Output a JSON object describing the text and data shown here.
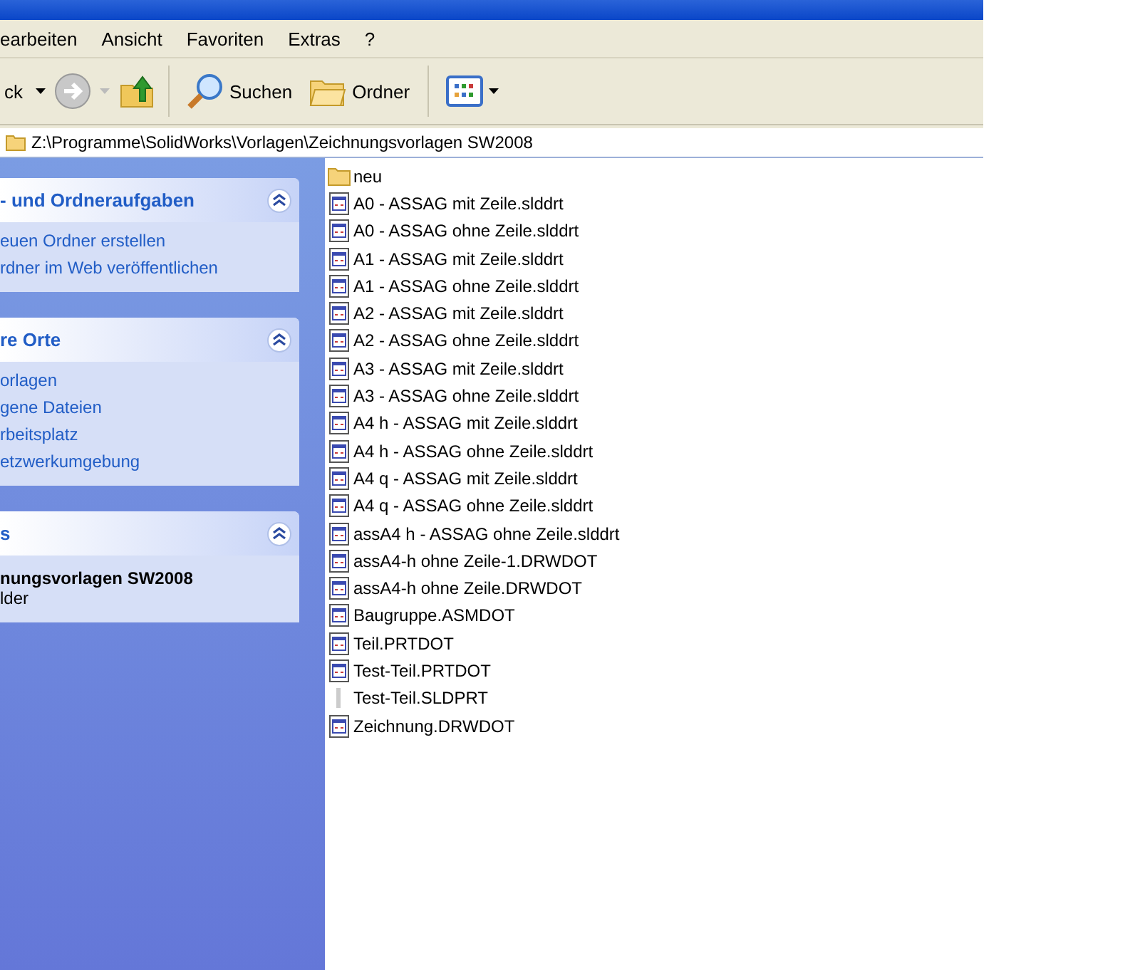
{
  "menu_bar": [
    "earbeiten",
    "Ansicht",
    "Favoriten",
    "Extras",
    "?"
  ],
  "toolbar": {
    "back": "ck",
    "search": "Suchen",
    "folders": "Ordner"
  },
  "address": "Z:\\Programme\\SolidWorks\\Vorlagen\\Zeichnungsvorlagen SW2008",
  "task_panels": [
    {
      "title": "- und Ordneraufgaben",
      "expanded": true,
      "kind": "links",
      "items": [
        "euen Ordner erstellen",
        "rdner im Web veröffentlichen"
      ]
    },
    {
      "title": "re Orte",
      "expanded": true,
      "kind": "links",
      "items": [
        "orlagen",
        "gene Dateien",
        "rbeitsplatz",
        "etzwerkumgebung"
      ]
    },
    {
      "title": "s",
      "expanded": true,
      "kind": "details",
      "items": [
        "nungsvorlagen SW2008",
        "lder"
      ]
    }
  ],
  "files": [
    {
      "name": "neu",
      "kind": "folder"
    },
    {
      "name": "A0 - ASSAG mit Zeile.slddrt",
      "kind": "template"
    },
    {
      "name": "A0 - ASSAG ohne Zeile.slddrt",
      "kind": "template"
    },
    {
      "name": "A1 - ASSAG mit Zeile.slddrt",
      "kind": "template"
    },
    {
      "name": "A1 - ASSAG ohne Zeile.slddrt",
      "kind": "template"
    },
    {
      "name": "A2 - ASSAG mit Zeile.slddrt",
      "kind": "template"
    },
    {
      "name": "A2 - ASSAG ohne Zeile.slddrt",
      "kind": "template"
    },
    {
      "name": "A3 - ASSAG mit Zeile.slddrt",
      "kind": "template"
    },
    {
      "name": "A3 - ASSAG ohne Zeile.slddrt",
      "kind": "template"
    },
    {
      "name": "A4 h - ASSAG mit Zeile.slddrt",
      "kind": "template"
    },
    {
      "name": "A4 h - ASSAG ohne Zeile.slddrt",
      "kind": "template"
    },
    {
      "name": "A4 q - ASSAG mit Zeile.slddrt",
      "kind": "template"
    },
    {
      "name": "A4 q - ASSAG ohne Zeile.slddrt",
      "kind": "template"
    },
    {
      "name": "assA4 h - ASSAG ohne Zeile.slddrt",
      "kind": "template"
    },
    {
      "name": "assA4-h ohne Zeile-1.DRWDOT",
      "kind": "template"
    },
    {
      "name": "assA4-h ohne Zeile.DRWDOT",
      "kind": "template"
    },
    {
      "name": "Baugruppe.ASMDOT",
      "kind": "template"
    },
    {
      "name": "Teil.PRTDOT",
      "kind": "template"
    },
    {
      "name": "Test-Teil.PRTDOT",
      "kind": "template"
    },
    {
      "name": "Test-Teil.SLDPRT",
      "kind": "generic"
    },
    {
      "name": "Zeichnung.DRWDOT",
      "kind": "template"
    }
  ]
}
